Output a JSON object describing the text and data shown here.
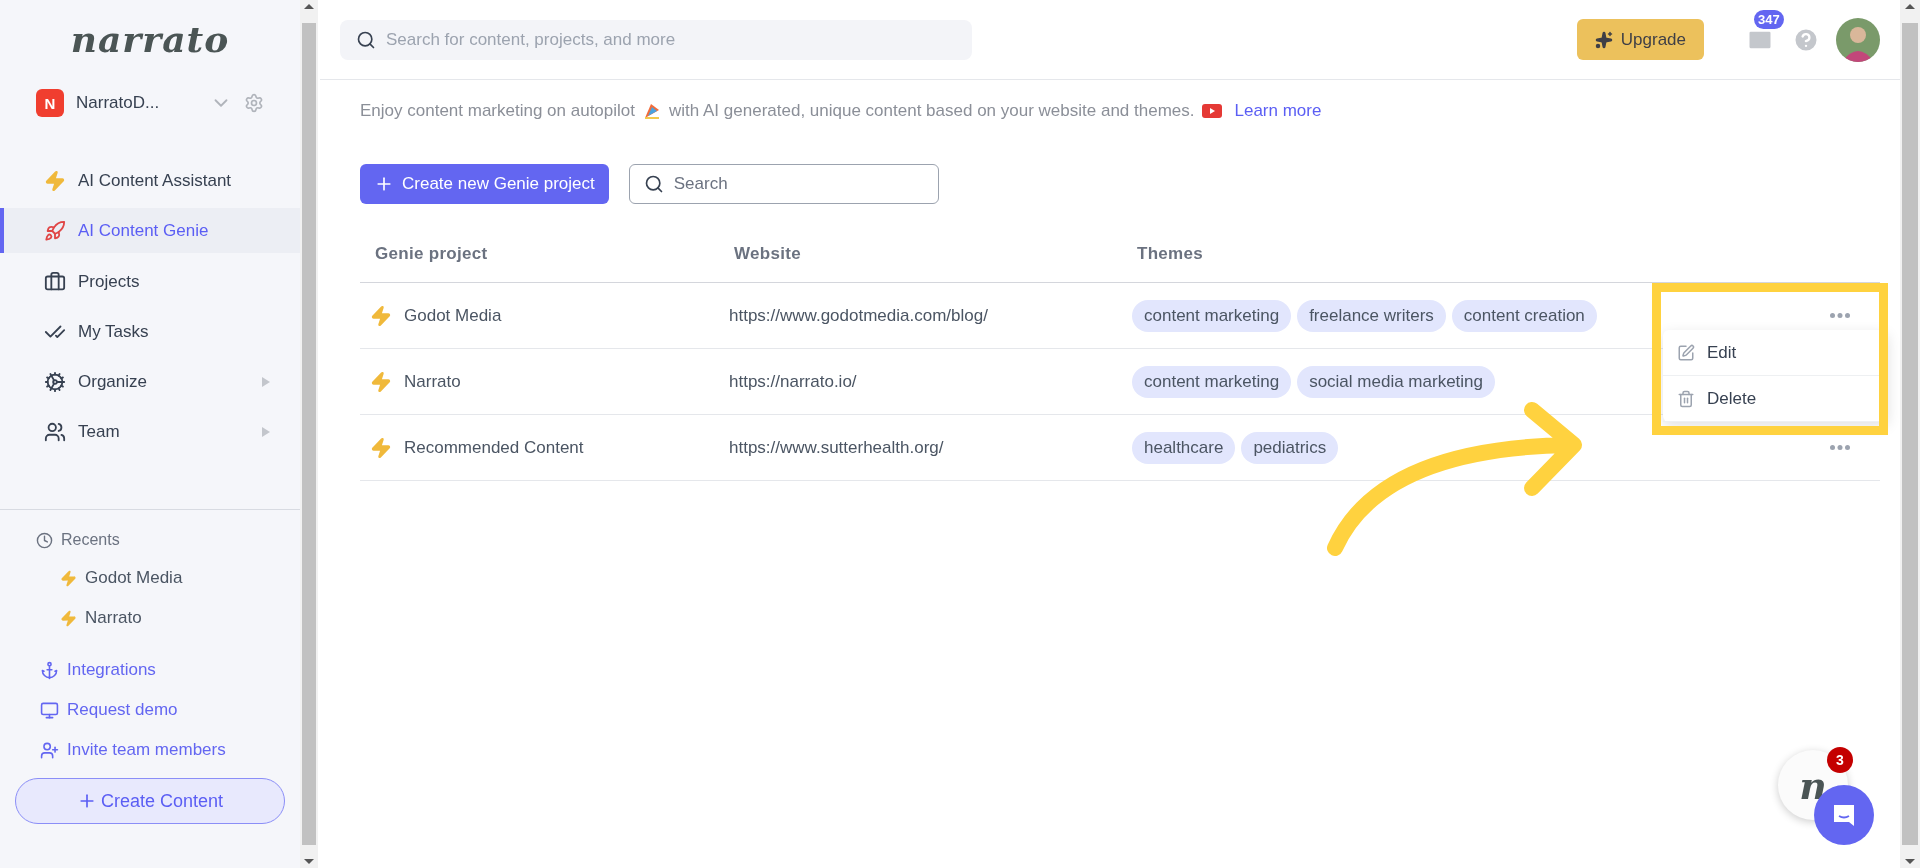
{
  "brand": {
    "logo": "narrato"
  },
  "workspace": {
    "initial": "N",
    "name": "NarratoD..."
  },
  "nav": [
    {
      "label": "AI Content Assistant",
      "selected": false,
      "submenu": false
    },
    {
      "label": "AI Content Genie",
      "selected": true,
      "submenu": false
    },
    {
      "label": "Projects",
      "selected": false,
      "submenu": false
    },
    {
      "label": "My Tasks",
      "selected": false,
      "submenu": false
    },
    {
      "label": "Organize",
      "selected": false,
      "submenu": true
    },
    {
      "label": "Team",
      "selected": false,
      "submenu": true
    }
  ],
  "recents": {
    "title": "Recents",
    "items": [
      "Godot Media",
      "Narrato"
    ]
  },
  "links": [
    "Integrations",
    "Request demo",
    "Invite team members"
  ],
  "create_button": "Create Content",
  "search": {
    "placeholder": "Search for content, projects, and more"
  },
  "upgrade": "Upgrade",
  "mail_badge": "347",
  "banner": {
    "text": "Enjoy content marketing on autopilot",
    "text_2": "with AI generated, unique content based on your website and themes.",
    "link": "Learn more"
  },
  "toolbar": {
    "create": "Create new Genie project",
    "search_placeholder": "Search"
  },
  "table": {
    "columns": [
      "Genie project",
      "Website",
      "Themes"
    ],
    "rows": [
      {
        "name": "Godot Media",
        "website": "https://www.godotmedia.com/blog/",
        "themes": [
          "content marketing",
          "freelance writers",
          "content creation"
        ],
        "menu": [
          {
            "label": "Edit",
            "kind": "edit"
          },
          {
            "label": "Delete",
            "kind": "delete"
          }
        ]
      },
      {
        "name": "Narrato",
        "website": "https://narrato.io/",
        "themes": [
          "content marketing",
          "social media marketing"
        ]
      },
      {
        "name": "Recommended Content",
        "website": "https://www.sutterhealth.org/",
        "themes": [
          "healthcare",
          "pediatrics"
        ]
      }
    ]
  },
  "chat": {
    "logo": "n",
    "badge": "3"
  }
}
